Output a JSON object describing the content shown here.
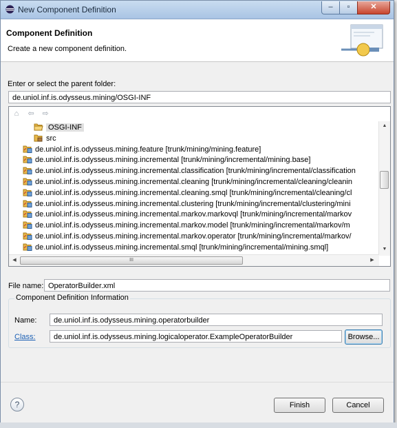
{
  "window": {
    "title": "New Component Definition",
    "min": "–",
    "max": "▫",
    "close": "✕"
  },
  "banner": {
    "title": "Component Definition",
    "description": "Create a new component definition."
  },
  "parent_folder": {
    "label": "Enter or select the parent folder:",
    "value": "de.uniol.inf.is.odysseus.mining/OSGI-INF"
  },
  "tree": {
    "toolbar_icons": [
      "home-icon",
      "back-icon",
      "forward-icon"
    ],
    "items": [
      {
        "label": "OSGI-INF",
        "indent": 2,
        "icon": "open-folder-icon",
        "selected": true
      },
      {
        "label": "src",
        "indent": 2,
        "icon": "package-folder-icon",
        "selected": false
      },
      {
        "label": "de.uniol.inf.is.odysseus.mining.feature [trunk/mining/mining.feature]",
        "indent": 1,
        "icon": "project-icon",
        "selected": false
      },
      {
        "label": "de.uniol.inf.is.odysseus.mining.incremental [trunk/mining/incremental/mining.base]",
        "indent": 1,
        "icon": "project-icon",
        "selected": false
      },
      {
        "label": "de.uniol.inf.is.odysseus.mining.incremental.classification [trunk/mining/incremental/classification",
        "indent": 1,
        "icon": "project-icon",
        "selected": false
      },
      {
        "label": "de.uniol.inf.is.odysseus.mining.incremental.cleaning [trunk/mining/incremental/cleaning/cleanin",
        "indent": 1,
        "icon": "project-icon",
        "selected": false
      },
      {
        "label": "de.uniol.inf.is.odysseus.mining.incremental.cleaning.smql [trunk/mining/incremental/cleaning/cl",
        "indent": 1,
        "icon": "project-icon",
        "selected": false
      },
      {
        "label": "de.uniol.inf.is.odysseus.mining.incremental.clustering [trunk/mining/incremental/clustering/mini",
        "indent": 1,
        "icon": "project-icon",
        "selected": false
      },
      {
        "label": "de.uniol.inf.is.odysseus.mining.incremental.markov.markovql [trunk/mining/incremental/markov",
        "indent": 1,
        "icon": "project-icon",
        "selected": false
      },
      {
        "label": "de.uniol.inf.is.odysseus.mining.incremental.markov.model [trunk/mining/incremental/markov/m",
        "indent": 1,
        "icon": "project-icon",
        "selected": false
      },
      {
        "label": "de.uniol.inf.is.odysseus.mining.incremental.markov.operator [trunk/mining/incremental/markov/",
        "indent": 1,
        "icon": "project-icon",
        "selected": false
      },
      {
        "label": "de.uniol.inf.is.odysseus.mining.incremental.smql [trunk/mining/incremental/mining.smql]",
        "indent": 1,
        "icon": "project-icon",
        "selected": false
      }
    ],
    "hscroll_thumb": "III"
  },
  "file_name": {
    "label": "File name:",
    "value": "OperatorBuilder.xml"
  },
  "component_info": {
    "title": "Component Definition Information",
    "name_label": "Name:",
    "name_value": "de.uniol.inf.is.odysseus.mining.operatorbuilder",
    "class_label": "Class:",
    "class_value": "de.uniol.inf.is.odysseus.mining.logicaloperator.ExampleOperatorBuilder",
    "browse_label": "Browse..."
  },
  "footer": {
    "help": "?",
    "finish_label": "Finish",
    "cancel_label": "Cancel"
  },
  "colors": {
    "title_gradient_top": "#c9dcf0",
    "link": "#1a5fb4",
    "close_button": "#c8452e"
  }
}
